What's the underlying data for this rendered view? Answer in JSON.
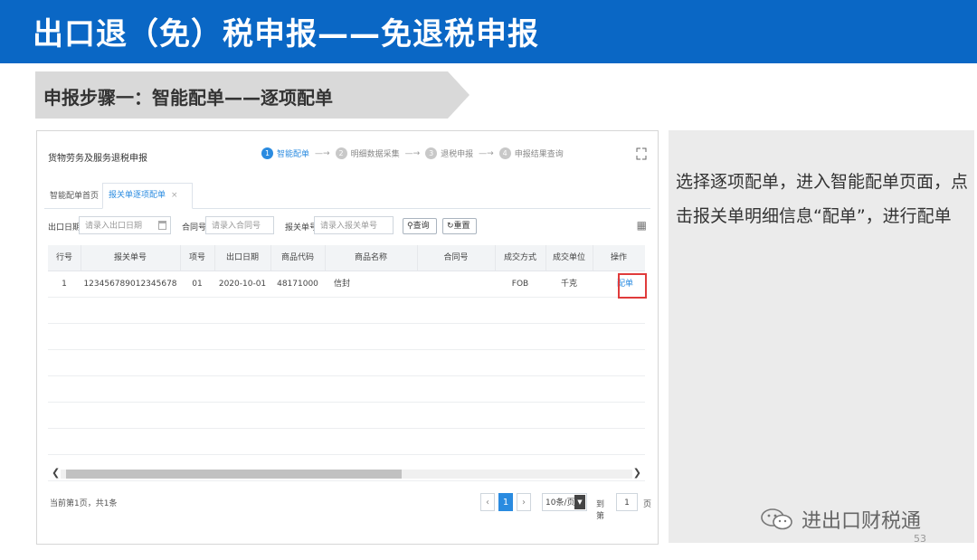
{
  "slide": {
    "title": "出口退（免）税申报——免退税申报",
    "step_title": "申报步骤一：智能配单——逐项配单",
    "side_text": "选择逐项配单，进入智能配单页面，点击报关单明细信息“配单”，进行配单",
    "watermark": "进出口财税通",
    "page_number": "53",
    "colors": {
      "banner": "#0a67c5",
      "accent": "#2a8be0",
      "highlight": "#e03b3b",
      "side_bg": "#ebebeb"
    }
  },
  "app": {
    "title": "货物劳务及服务退税申报",
    "wizard": [
      {
        "num": "1",
        "label": "智能配单",
        "active": true
      },
      {
        "num": "2",
        "label": "明细数据采集",
        "active": false
      },
      {
        "num": "3",
        "label": "退税申报",
        "active": false
      },
      {
        "num": "4",
        "label": "申报结果查询",
        "active": false
      }
    ],
    "wizard_arrow": "—→",
    "tabs": {
      "home": "智能配单首页",
      "active": "报关单逐项配单",
      "close": "×"
    },
    "filters": {
      "export_date_label": "出口日期",
      "export_date_placeholder": "请录入出口日期",
      "contract_label": "合同号",
      "contract_placeholder": "请录入合同号",
      "customs_label": "报关单号",
      "customs_placeholder": "请录入报关单号",
      "query_label": "查询",
      "reset_label": "重置"
    },
    "table": {
      "headers": [
        "行号",
        "报关单号",
        "项号",
        "出口日期",
        "商品代码",
        "商品名称",
        "合同号",
        "成交方式",
        "成交单位",
        "操作"
      ],
      "rows": [
        [
          "1",
          "123456789012345678",
          "01",
          "2020-10-01",
          "48171000",
          "信封",
          "",
          "FOB",
          "千克",
          "配单"
        ]
      ]
    },
    "footer": {
      "info": "当前第1页，共1条",
      "current_page": "1",
      "page_size": "10条/页",
      "goto_label": "到第",
      "goto_value": "1",
      "page_suffix": "页"
    }
  }
}
